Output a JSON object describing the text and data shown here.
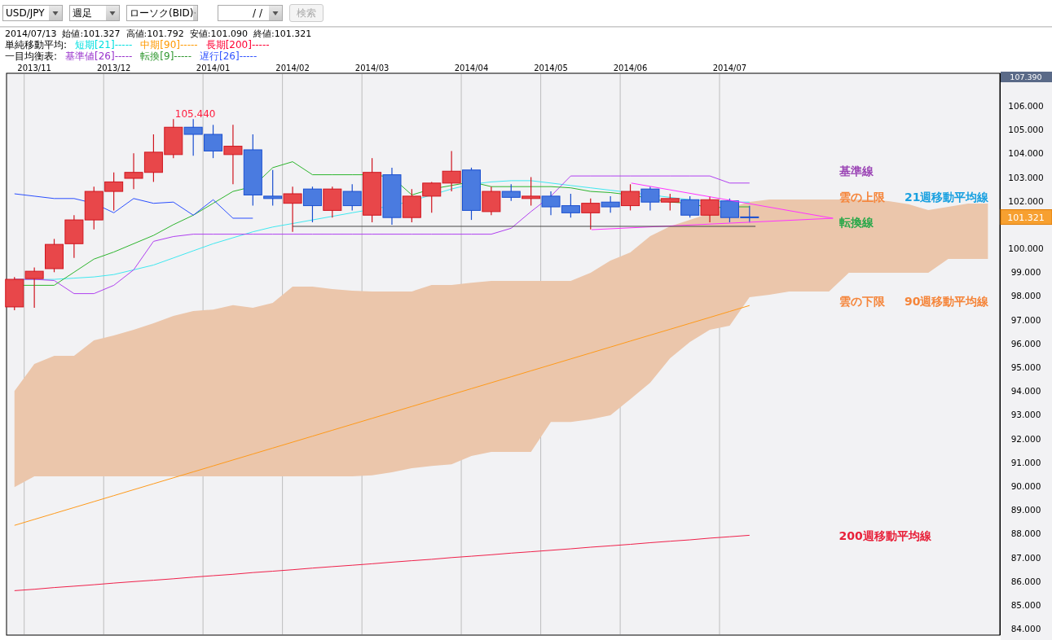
{
  "toolbar": {
    "symbol": {
      "value": "USD/JPY"
    },
    "period": {
      "value": "週足"
    },
    "chart_type": {
      "value": "ローソク(BID)"
    },
    "date": {
      "value": "/   /"
    },
    "search_button": {
      "label": "検索",
      "disabled": true
    }
  },
  "info": {
    "date": "2014/07/13",
    "open": "始値:101.327",
    "high": "高値:101.792",
    "low": "安値:101.090",
    "close": "終値:101.321"
  },
  "legend": [
    {
      "title": "単純移動平均:",
      "items": [
        {
          "label": "短期[21]-----",
          "color": "#00e0e0"
        },
        {
          "label": "中期[90]-----",
          "color": "#ff9900"
        },
        {
          "label": "長期[200]-----",
          "color": "#ff0033"
        }
      ]
    },
    {
      "title": "一目均衡表:",
      "items": [
        {
          "label": "基準値[26]-----",
          "color": "#9933cc"
        },
        {
          "label": "転換[9]-----",
          "color": "#339933"
        },
        {
          "label": "遅行[26]-----",
          "color": "#3355ff"
        }
      ]
    }
  ],
  "chart": {
    "month_labels": [
      "2013/11",
      "2013/12",
      "2014/01",
      "2014/02",
      "2014/03",
      "2014/04",
      "2014/05",
      "2014/06",
      "2014/07"
    ],
    "price_axis": [
      "106.000",
      "105.000",
      "104.000",
      "103.000",
      "102.000",
      "100.000",
      "99.000",
      "98.000",
      "97.000",
      "96.000",
      "95.000",
      "94.000",
      "93.000",
      "92.000",
      "91.000",
      "90.000",
      "89.000",
      "88.000",
      "87.000",
      "86.000",
      "85.000",
      "84.000"
    ],
    "high_label": "105.440",
    "notes": [
      {
        "text": "基準線",
        "color": "#9b45b5"
      },
      {
        "text": "雲の上限",
        "color": "#f5853a"
      },
      {
        "text": "21週移動平均線",
        "color": "#18a0e0"
      },
      {
        "text": "転換線",
        "color": "#2aa84a"
      },
      {
        "text": "雲の下限",
        "color": "#f5853a"
      },
      {
        "text": "90週移動平均線",
        "color": "#f5853a"
      },
      {
        "text": "200週移動平均線",
        "color": "#e8213a"
      }
    ],
    "period_high": "107.390",
    "last_price": "101.321"
  }
}
